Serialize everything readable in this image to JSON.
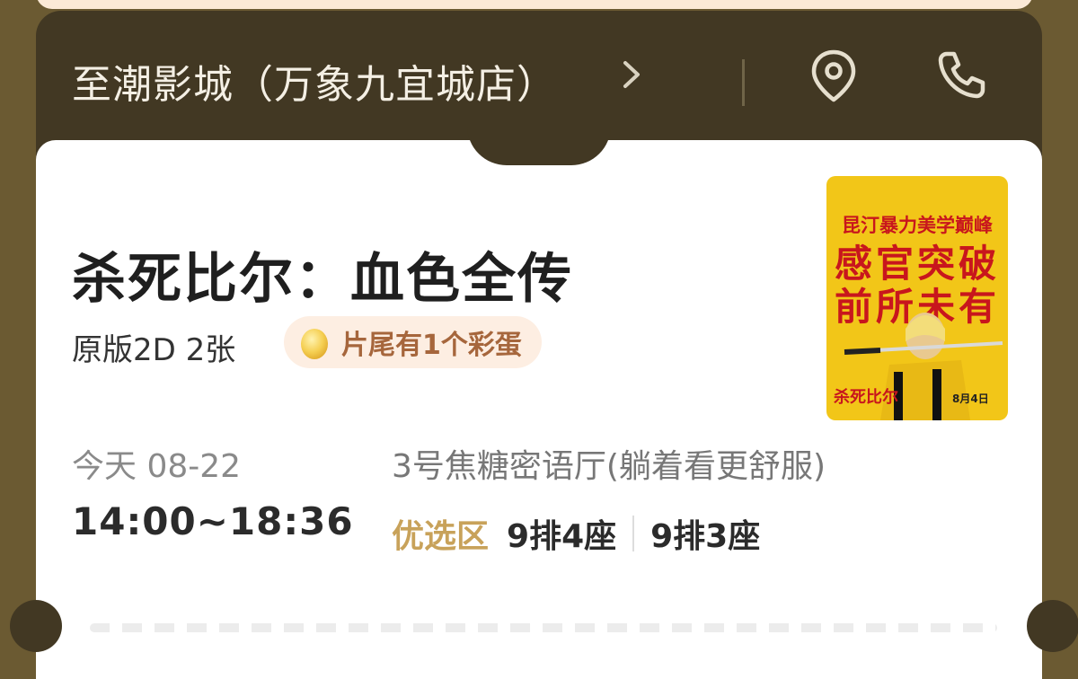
{
  "cinema": {
    "name": "至潮影城（万象九宜城店）"
  },
  "movie": {
    "title": "杀死比尔：血色全传",
    "meta": "原版2D 2张",
    "egg_badge": "片尾有1个彩蛋"
  },
  "poster": {
    "line1": "昆汀暴力美学巅峰",
    "line2": "感官突破",
    "line3": "前所未有",
    "footer_title": "杀死比尔",
    "footer_date": "8月4日"
  },
  "showtime": {
    "date": "今天 08-22",
    "time_range": "14:00~18:36",
    "hall": "3号焦糖密语厅(躺着看更舒服)",
    "zone": "优选区",
    "seats": [
      "9排4座",
      "9排3座"
    ]
  },
  "icons": {
    "chevron": "chevron-right-icon",
    "location": "location-pin-icon",
    "phone": "phone-icon",
    "egg": "egg-icon"
  },
  "colors": {
    "ticket_dark": "#423823",
    "accent_gold": "#c8a25a",
    "badge_bg": "#fdeee2",
    "badge_text": "#a6663c",
    "poster_yellow": "#f2c618",
    "poster_red": "#c8161d"
  }
}
